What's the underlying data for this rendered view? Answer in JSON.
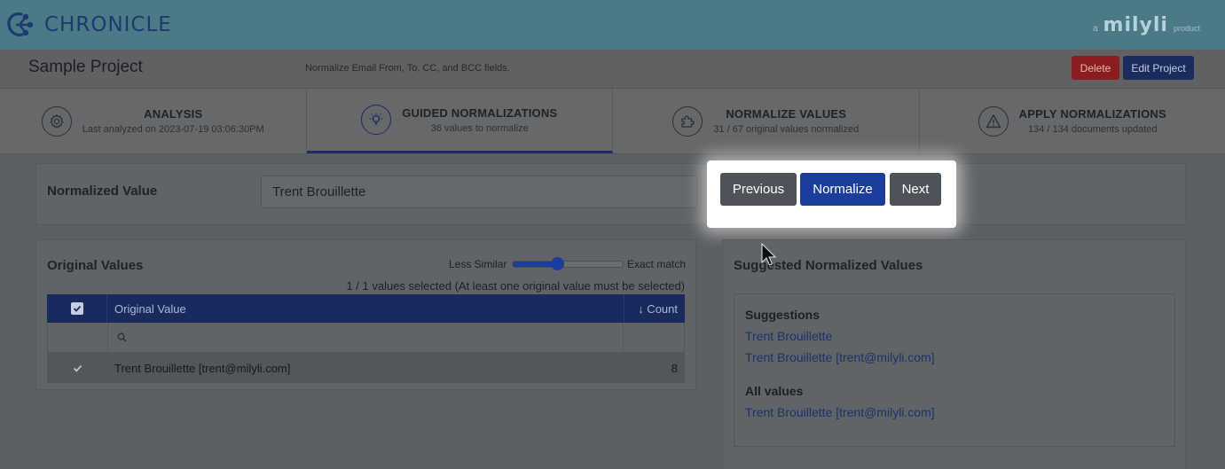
{
  "header": {
    "brand_name": "CHRONICLE",
    "maker_prefix": "a",
    "maker_logo": "milyli",
    "maker_suffix": "product",
    "brand_color": "#4a7a86"
  },
  "project": {
    "title": "Sample Project",
    "description": "Normalize Email From, To, CC, and BCC fields.",
    "delete_label": "Delete",
    "edit_label": "Edit Project"
  },
  "steps": [
    {
      "title": "ANALYSIS",
      "subtitle": "Last analyzed on 2023-07-19 03:06:30PM",
      "icon": "gear-icon"
    },
    {
      "title": "GUIDED NORMALIZATIONS",
      "subtitle": "36 values to normalize",
      "icon": "lightbulb-icon",
      "active": true
    },
    {
      "title": "NORMALIZE VALUES",
      "subtitle": "31 / 67 original values normalized",
      "icon": "puzzle-icon"
    },
    {
      "title": "APPLY NORMALIZATIONS",
      "subtitle": "134 / 134 documents updated",
      "icon": "warning-icon"
    }
  ],
  "normalized": {
    "label": "Normalized Value",
    "value": "Trent Brouillette",
    "previous_label": "Previous",
    "normalize_label": "Normalize",
    "next_label": "Next"
  },
  "original_values": {
    "title": "Original Values",
    "slider_less": "Less Similar",
    "slider_exact": "Exact match",
    "slider_level": 0.4,
    "selected_text": "1 / 1 values selected (At least one original value must be selected)",
    "columns": {
      "value": "Original Value",
      "count": "↓ Count"
    },
    "rows": [
      {
        "value": "Trent Brouillette [trent@milyli.com]",
        "count": "8",
        "checked": true
      }
    ]
  },
  "suggested": {
    "title": "Suggested Normalized Values",
    "suggestions_heading": "Suggestions",
    "suggestions": [
      "Trent Brouillette",
      "Trent Brouillette [trent@milyli.com]"
    ],
    "all_values_heading": "All values",
    "all_values": [
      "Trent Brouillette [trent@milyli.com]"
    ]
  },
  "colors": {
    "accent": "#1b3d9c",
    "delete": "#8b1c1f",
    "table_header": "#1b2a5e"
  }
}
